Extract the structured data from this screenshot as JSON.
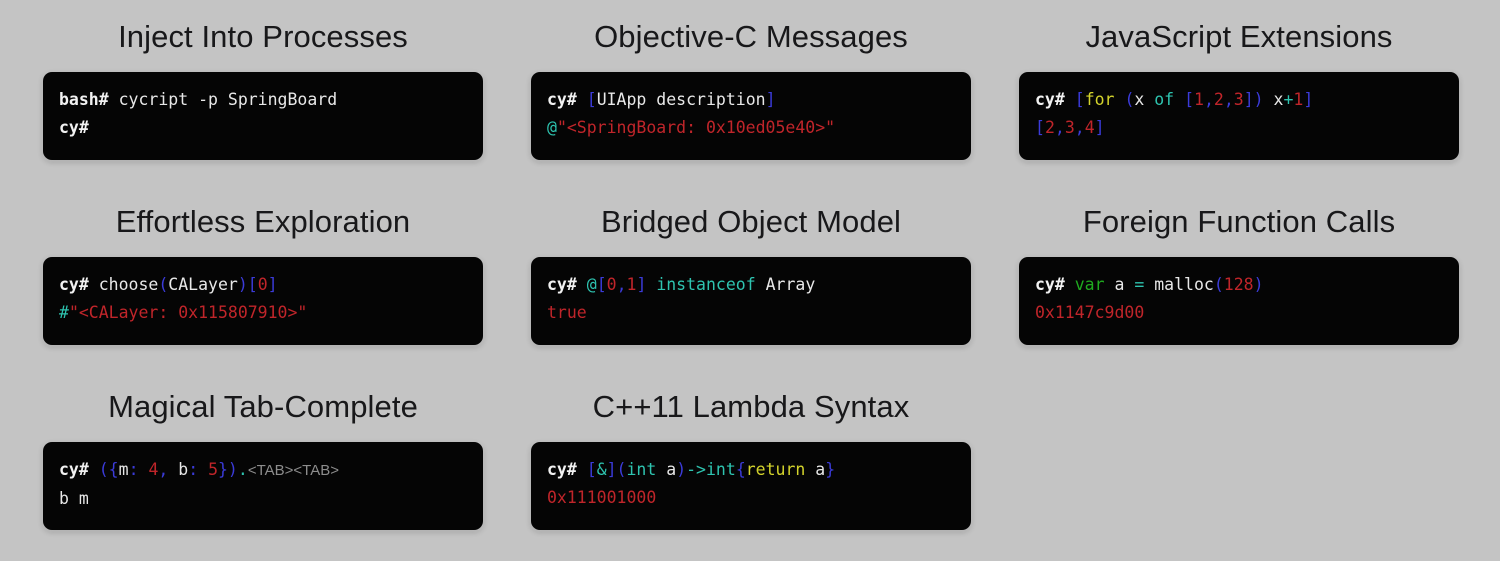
{
  "page": {
    "background_color": "#c4c4c4",
    "terminal_background": "#050505"
  },
  "palette": {
    "prompt": "#f2f2f2",
    "plain": "#e8e8e8",
    "bracket_blue": "#3b3bd9",
    "teal": "#2ec4b0",
    "string_red": "#c0252a",
    "keyword_yellow": "#d4d42c",
    "keyword_green": "#1faa1f",
    "hint_gray": "#8d8d8d",
    "title_text": "#18181a"
  },
  "features": [
    {
      "id": "inject-into-processes",
      "title": "Inject Into Processes",
      "lines": [
        [
          {
            "text": "bash# ",
            "token": "prompt"
          },
          {
            "text": "cycript -p SpringBoard",
            "token": "plain"
          }
        ],
        [
          {
            "text": "cy#",
            "token": "prompt"
          }
        ]
      ]
    },
    {
      "id": "objective-c-messages",
      "title": "Objective-C Messages",
      "lines": [
        [
          {
            "text": "cy# ",
            "token": "prompt"
          },
          {
            "text": "[",
            "token": "brk"
          },
          {
            "text": "UIApp description",
            "token": "plain"
          },
          {
            "text": "]",
            "token": "brk"
          }
        ],
        [
          {
            "text": "@",
            "token": "teal"
          },
          {
            "text": "\"<SpringBoard: 0x10ed05e40>\"",
            "token": "red"
          }
        ]
      ]
    },
    {
      "id": "javascript-extensions",
      "title": "JavaScript Extensions",
      "lines": [
        [
          {
            "text": "cy# ",
            "token": "prompt"
          },
          {
            "text": "[",
            "token": "brk"
          },
          {
            "text": "for",
            "token": "yellow"
          },
          {
            "text": " ",
            "token": "plain"
          },
          {
            "text": "(",
            "token": "brk"
          },
          {
            "text": "x ",
            "token": "plain"
          },
          {
            "text": "of",
            "token": "teal"
          },
          {
            "text": " ",
            "token": "plain"
          },
          {
            "text": "[",
            "token": "brk"
          },
          {
            "text": "1",
            "token": "red"
          },
          {
            "text": ",",
            "token": "brk"
          },
          {
            "text": "2",
            "token": "red"
          },
          {
            "text": ",",
            "token": "brk"
          },
          {
            "text": "3",
            "token": "red"
          },
          {
            "text": "])",
            "token": "brk"
          },
          {
            "text": " x",
            "token": "plain"
          },
          {
            "text": "+",
            "token": "teal"
          },
          {
            "text": "1",
            "token": "red"
          },
          {
            "text": "]",
            "token": "brk"
          }
        ],
        [
          {
            "text": "[",
            "token": "brk"
          },
          {
            "text": "2",
            "token": "red"
          },
          {
            "text": ",",
            "token": "brk"
          },
          {
            "text": "3",
            "token": "red"
          },
          {
            "text": ",",
            "token": "brk"
          },
          {
            "text": "4",
            "token": "red"
          },
          {
            "text": "]",
            "token": "brk"
          }
        ]
      ]
    },
    {
      "id": "effortless-exploration",
      "title": "Effortless Exploration",
      "lines": [
        [
          {
            "text": "cy# ",
            "token": "prompt"
          },
          {
            "text": "choose",
            "token": "plain"
          },
          {
            "text": "(",
            "token": "brk"
          },
          {
            "text": "CALayer",
            "token": "plain"
          },
          {
            "text": ")",
            "token": "brk"
          },
          {
            "text": "[",
            "token": "brk"
          },
          {
            "text": "0",
            "token": "red"
          },
          {
            "text": "]",
            "token": "brk"
          }
        ],
        [
          {
            "text": "#",
            "token": "teal"
          },
          {
            "text": "\"<CALayer: 0x115807910>\"",
            "token": "red"
          }
        ]
      ]
    },
    {
      "id": "bridged-object-model",
      "title": "Bridged Object Model",
      "lines": [
        [
          {
            "text": "cy# ",
            "token": "prompt"
          },
          {
            "text": "@",
            "token": "teal"
          },
          {
            "text": "[",
            "token": "brk"
          },
          {
            "text": "0",
            "token": "red"
          },
          {
            "text": ",",
            "token": "brk"
          },
          {
            "text": "1",
            "token": "red"
          },
          {
            "text": "]",
            "token": "brk"
          },
          {
            "text": " ",
            "token": "plain"
          },
          {
            "text": "instanceof",
            "token": "teal"
          },
          {
            "text": " Array",
            "token": "plain"
          }
        ],
        [
          {
            "text": "true",
            "token": "red"
          }
        ]
      ]
    },
    {
      "id": "foreign-function-calls",
      "title": "Foreign Function Calls",
      "lines": [
        [
          {
            "text": "cy# ",
            "token": "prompt"
          },
          {
            "text": "var",
            "token": "green"
          },
          {
            "text": " a ",
            "token": "plain"
          },
          {
            "text": "=",
            "token": "teal"
          },
          {
            "text": " malloc",
            "token": "plain"
          },
          {
            "text": "(",
            "token": "brk"
          },
          {
            "text": "128",
            "token": "red"
          },
          {
            "text": ")",
            "token": "brk"
          }
        ],
        [
          {
            "text": "0x1147c9d00",
            "token": "red"
          }
        ]
      ]
    },
    {
      "id": "magical-tab-complete",
      "title": "Magical Tab-Complete",
      "lines": [
        [
          {
            "text": "cy# ",
            "token": "prompt"
          },
          {
            "text": "({",
            "token": "brk"
          },
          {
            "text": "m",
            "token": "plain"
          },
          {
            "text": ":",
            "token": "brk"
          },
          {
            "text": " ",
            "token": "plain"
          },
          {
            "text": "4",
            "token": "red"
          },
          {
            "text": ",",
            "token": "brk"
          },
          {
            "text": " b",
            "token": "plain"
          },
          {
            "text": ":",
            "token": "brk"
          },
          {
            "text": " ",
            "token": "plain"
          },
          {
            "text": "5",
            "token": "red"
          },
          {
            "text": "})",
            "token": "brk"
          },
          {
            "text": ".",
            "token": "teal"
          },
          {
            "text": "<TAB><TAB>",
            "token": "gray"
          }
        ],
        [
          {
            "text": "b m",
            "token": "plain"
          }
        ]
      ]
    },
    {
      "id": "cpp11-lambda-syntax",
      "title": "C++11 Lambda Syntax",
      "lines": [
        [
          {
            "text": "cy# ",
            "token": "prompt"
          },
          {
            "text": "[",
            "token": "brk"
          },
          {
            "text": "&",
            "token": "teal"
          },
          {
            "text": "](",
            "token": "brk"
          },
          {
            "text": "int",
            "token": "teal"
          },
          {
            "text": " a",
            "token": "plain"
          },
          {
            "text": ")",
            "token": "brk"
          },
          {
            "text": "->",
            "token": "teal"
          },
          {
            "text": "int",
            "token": "teal"
          },
          {
            "text": "{",
            "token": "brk"
          },
          {
            "text": "return",
            "token": "yellow"
          },
          {
            "text": " a",
            "token": "plain"
          },
          {
            "text": "}",
            "token": "brk"
          }
        ],
        [
          {
            "text": "0x111001000",
            "token": "red"
          }
        ]
      ]
    }
  ]
}
